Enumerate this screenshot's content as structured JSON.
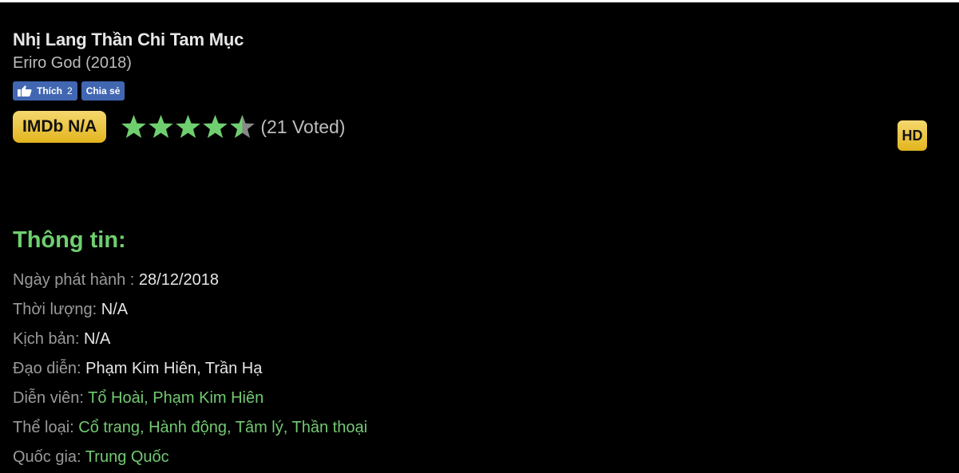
{
  "movie": {
    "title": "Nhị Lang Thần Chi Tam Mục",
    "subtitle": "Eriro God (2018)",
    "quality_badge": "HD"
  },
  "social": {
    "like_label": "Thích",
    "like_count": "2",
    "share_label": "Chia sẻ"
  },
  "rating": {
    "imdb_label": "IMDb N/A",
    "stars_filled": 4.5,
    "stars_total": 5,
    "voted_text": "(21 Voted)"
  },
  "info": {
    "section_title": "Thông tin:",
    "release_label": "Ngày phát hành : ",
    "release_value": "28/12/2018",
    "duration_label": "Thời lượng: ",
    "duration_value": "N/A",
    "script_label": "Kịch bản: ",
    "script_value": "N/A",
    "director_label": "Đạo diễn: ",
    "director_value": "Phạm Kim Hiên, Trần Hạ",
    "cast_label": "Diễn viên: ",
    "cast": [
      "Tổ Hoài",
      "Phạm Kim Hiên"
    ],
    "genre_label": "Thể loại: ",
    "genres": [
      "Cổ trang",
      "Hành động",
      "Tâm lý",
      "Thần thoại"
    ],
    "country_label": "Quốc gia: ",
    "country_value": "Trung Quốc"
  },
  "colors": {
    "accent_green": "#6fcf6f",
    "imdb_gold": "#e2b51e",
    "facebook_blue": "#4267b2",
    "star_green": "#6fcf6f",
    "star_grey": "#888888"
  },
  "icons": {
    "like": "thumbs-up-icon",
    "star": "star-icon"
  }
}
